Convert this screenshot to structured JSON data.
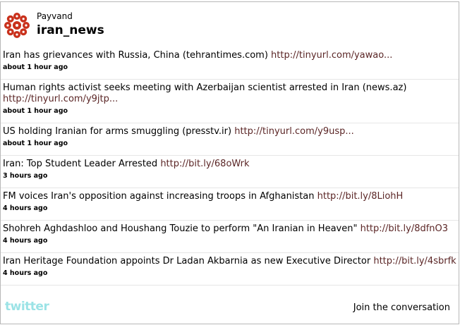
{
  "profile": {
    "name": "Payvand",
    "handle": "iran_news"
  },
  "tweets": [
    {
      "text": "Iran has grievances with Russia, China (tehrantimes.com) ",
      "link": "http://tinyurl.com/yawao...",
      "time": "about 1 hour ago"
    },
    {
      "text": "Human rights activist seeks meeting with Azerbaijan scientist arrested in Iran (news.az) ",
      "link": "http://tinyurl.com/y9jtp...",
      "time": "about 1 hour ago"
    },
    {
      "text": "US holding Iranian for arms smuggling (presstv.ir) ",
      "link": "http://tinyurl.com/y9usp...",
      "time": "about 1 hour ago"
    },
    {
      "text": "Iran: Top Student Leader Arrested ",
      "link": "http://bit.ly/68oWrk",
      "time": "3 hours ago"
    },
    {
      "text": "FM voices Iran's opposition against increasing troops in Afghanistan ",
      "link": "http://bit.ly/8LiohH",
      "time": "4 hours ago"
    },
    {
      "text": "Shohreh Aghdashloo and Houshang Touzie to perform \"An Iranian in Heaven\" ",
      "link": "http://bit.ly/8dfnO3",
      "time": "4 hours ago"
    },
    {
      "text": "Iran Heritage Foundation appoints Dr Ladan Akbarnia as new Executive Director ",
      "link": "http://bit.ly/4sbrfk",
      "time": "4 hours ago"
    }
  ],
  "footer": {
    "logo_text": "twitter",
    "join_label": "Join the conversation"
  },
  "colors": {
    "link": "#5b2626",
    "logo_red": "#c9311c",
    "twitter_blue": "#9be3e6"
  }
}
